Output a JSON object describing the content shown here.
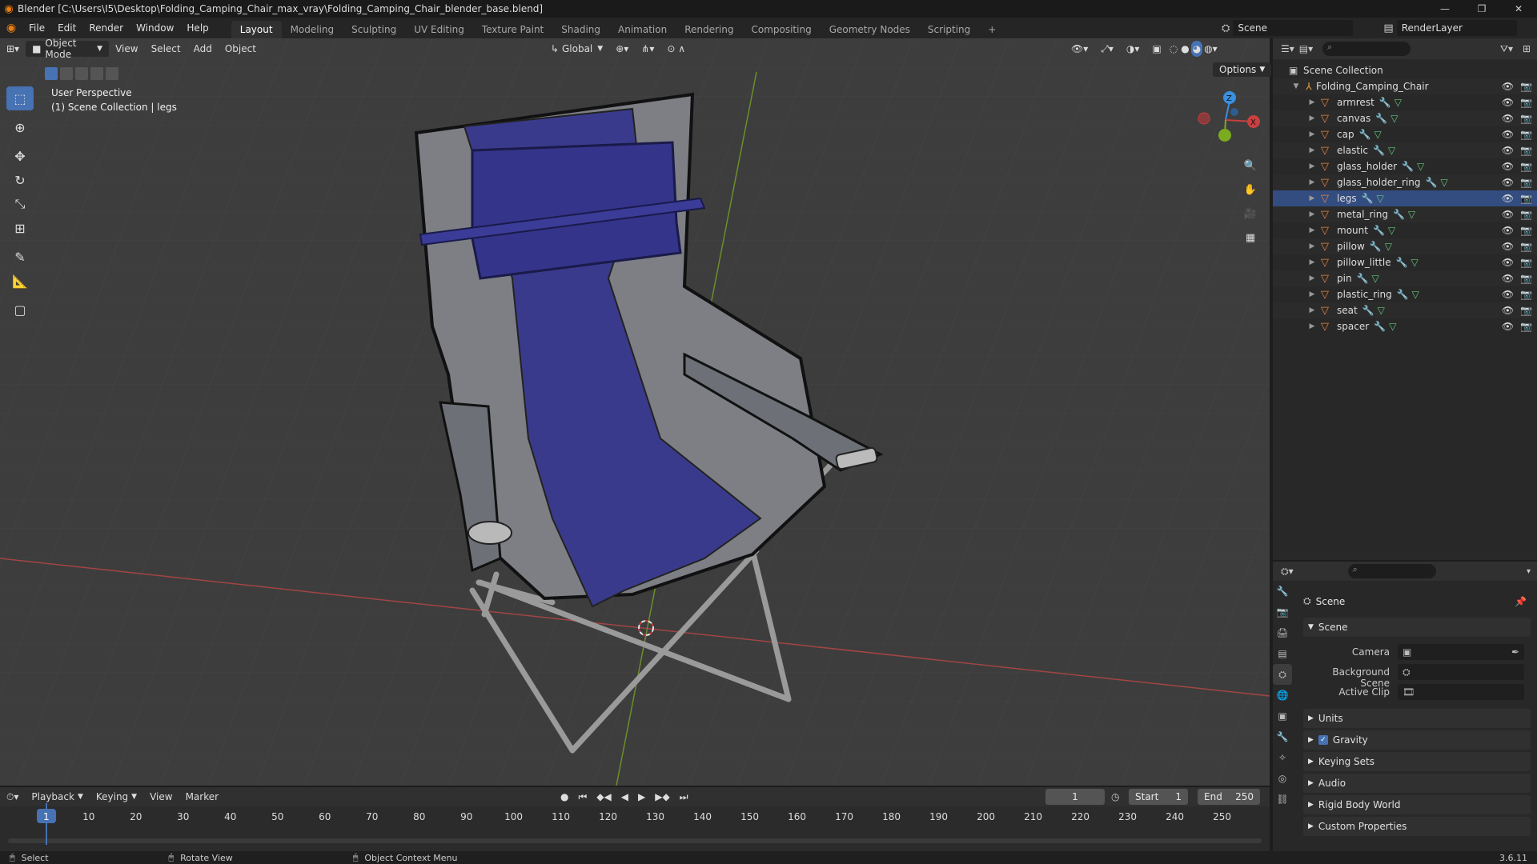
{
  "window": {
    "title": "Blender [C:\\Users\\I5\\Desktop\\Folding_Camping_Chair_max_vray\\Folding_Camping_Chair_blender_base.blend]",
    "minimize": "—",
    "maximize": "❐",
    "close": "✕"
  },
  "menu": [
    "File",
    "Edit",
    "Render",
    "Window",
    "Help"
  ],
  "workspaces": [
    "Layout",
    "Modeling",
    "Sculpting",
    "UV Editing",
    "Texture Paint",
    "Shading",
    "Animation",
    "Rendering",
    "Compositing",
    "Geometry Nodes",
    "Scripting"
  ],
  "workspace_add": "+",
  "active_workspace": "Layout",
  "scene_name": "Scene",
  "view_layer": "RenderLayer",
  "viewport": {
    "mode": "Object Mode",
    "menus": [
      "View",
      "Select",
      "Add",
      "Object"
    ],
    "transform_orientation": "Global",
    "options_label": "Options",
    "perspective": "User Perspective",
    "collection_info": "(1) Scene Collection | legs"
  },
  "outliner": {
    "root": "Scene Collection",
    "collection": "Folding_Camping_Chair",
    "objects": [
      "armrest",
      "canvas",
      "cap",
      "elastic",
      "glass_holder",
      "glass_holder_ring",
      "legs",
      "metal_ring",
      "mount",
      "pillow",
      "pillow_little",
      "pin",
      "plastic_ring",
      "seat",
      "spacer"
    ]
  },
  "properties": {
    "header": "Scene",
    "panel": "Scene",
    "camera_label": "Camera",
    "background_scene_label": "Background Scene",
    "active_clip_label": "Active Clip",
    "sections": [
      "Units",
      "Gravity",
      "Keying Sets",
      "Audio",
      "Rigid Body World",
      "Custom Properties"
    ]
  },
  "timeline": {
    "menus": [
      "Playback",
      "Keying",
      "View",
      "Marker"
    ],
    "current_frame": "1",
    "start_label": "Start",
    "start": "1",
    "end_label": "End",
    "end": "250",
    "ruler": [
      "1",
      "10",
      "20",
      "30",
      "40",
      "50",
      "60",
      "70",
      "80",
      "90",
      "100",
      "110",
      "120",
      "130",
      "140",
      "150",
      "160",
      "170",
      "180",
      "190",
      "200",
      "210",
      "220",
      "230",
      "240",
      "250"
    ]
  },
  "statusbar": {
    "select": "Select",
    "rotate": "Rotate View",
    "context": "Object Context Menu",
    "version": "3.6.11"
  },
  "colors": {
    "accent": "#4772b3",
    "mesh_icon": "#e8843c",
    "axis_x": "#c8403f",
    "axis_y": "#7bab1f",
    "axis_z": "#3a8fe0",
    "canvas_blue": "#3a3a8c",
    "canvas_grey": "#7d7f85"
  }
}
